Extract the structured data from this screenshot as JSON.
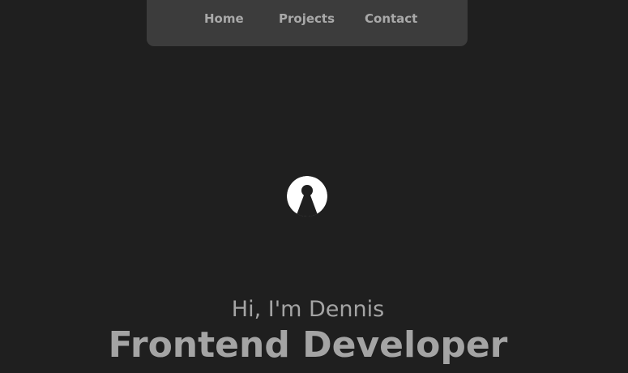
{
  "nav": {
    "items": [
      {
        "label": "Home"
      },
      {
        "label": "Projects"
      },
      {
        "label": "Contact"
      }
    ]
  },
  "hero": {
    "avatar_icon": "user-avatar-icon",
    "greeting": "Hi, I'm Dennis",
    "title": "Frontend Developer"
  },
  "colors": {
    "background": "#1f1f1f",
    "nav_background": "#3c3c3c",
    "text": "#a4a4a4"
  }
}
